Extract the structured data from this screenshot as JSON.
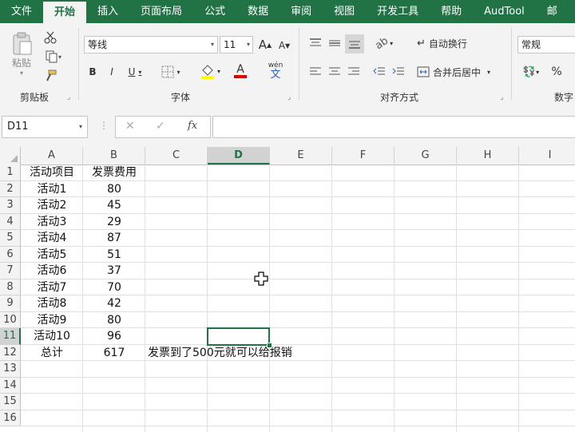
{
  "tabs": [
    "文件",
    "开始",
    "插入",
    "页面布局",
    "公式",
    "数据",
    "审阅",
    "视图",
    "开发工具",
    "帮助",
    "AudTool",
    "邮"
  ],
  "active_tab": "开始",
  "ribbon": {
    "clipboard": {
      "label": "剪贴板",
      "paste": "粘贴"
    },
    "font": {
      "label": "字体",
      "name": "等线",
      "size": "11",
      "bold": "B",
      "italic": "I",
      "underline": "U",
      "grow": "A",
      "shrink": "A",
      "font_color_label": "A",
      "phonetic": "wén"
    },
    "alignment": {
      "label": "对齐方式",
      "wrap_text": "自动换行",
      "merge_center": "合并后居中"
    },
    "number": {
      "label": "数字",
      "format": "常规",
      "percent": "%"
    }
  },
  "formula_bar": {
    "name_box": "D11",
    "cancel_symbol": "✕",
    "enter_symbol": "✓",
    "fx_symbol": "fx",
    "formula": ""
  },
  "sheet": {
    "columns": [
      "A",
      "B",
      "C",
      "D",
      "E",
      "F",
      "G",
      "H",
      "I"
    ],
    "selected_column": "D",
    "selected_row": "11",
    "rows": [
      "1",
      "2",
      "3",
      "4",
      "5",
      "6",
      "7",
      "8",
      "9",
      "10",
      "11",
      "12",
      "13",
      "14",
      "15",
      "16"
    ],
    "cells": {
      "A1": "活动项目",
      "B1": "发票费用",
      "A2": "活动1",
      "B2": "80",
      "A3": "活动2",
      "B3": "45",
      "A4": "活动3",
      "B4": "29",
      "A5": "活动4",
      "B5": "87",
      "A6": "活动5",
      "B6": "51",
      "A7": "活动6",
      "B7": "37",
      "A8": "活动7",
      "B8": "70",
      "A9": "活动8",
      "B9": "42",
      "A10": "活动9",
      "B10": "80",
      "A11": "活动10",
      "B11": "96",
      "A12": "总计",
      "B12": "617",
      "C12": "发票到了500元就可以给报销"
    }
  },
  "colors": {
    "accent": "#217346",
    "ribbon_bg": "#f3f3f3",
    "gridline": "#e1e1e1"
  }
}
